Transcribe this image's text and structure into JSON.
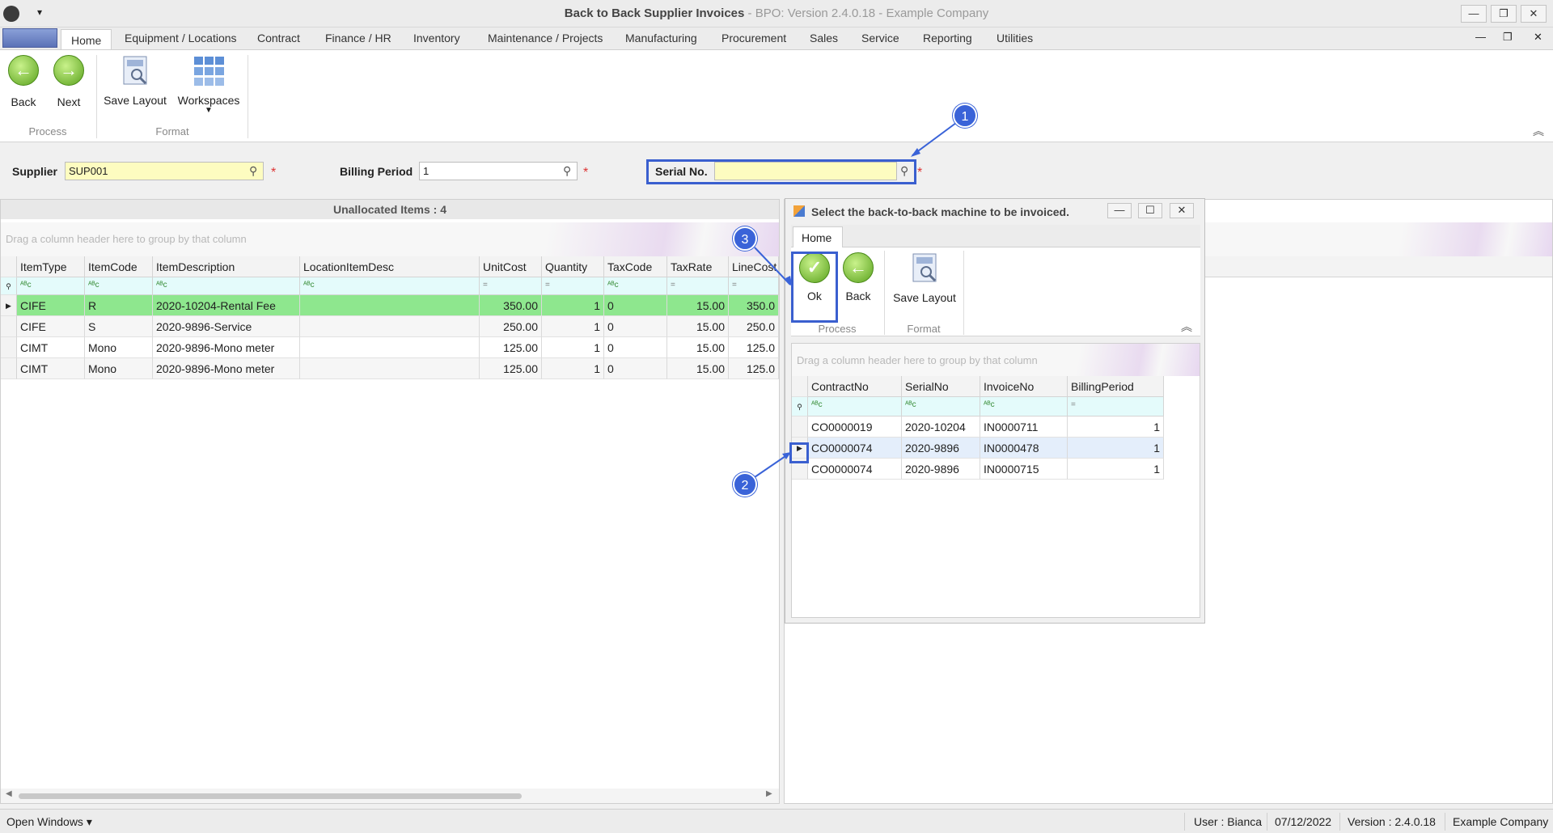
{
  "window": {
    "title_main": "Back to Back Supplier Invoices",
    "title_sub": "- BPO: Version 2.4.0.18 - Example Company"
  },
  "tabs": [
    "Home",
    "Equipment / Locations",
    "Contract",
    "Finance / HR",
    "Inventory",
    "Maintenance / Projects",
    "Manufacturing",
    "Procurement",
    "Sales",
    "Service",
    "Reporting",
    "Utilities"
  ],
  "ribbon": {
    "back": "Back",
    "next": "Next",
    "save_layout": "Save Layout",
    "workspaces": "Workspaces",
    "group_process": "Process",
    "group_format": "Format"
  },
  "filters": {
    "supplier_label": "Supplier",
    "supplier_value": "SUP001",
    "billing_label": "Billing Period",
    "billing_value": "1",
    "serial_label": "Serial No.",
    "serial_value": "",
    "req": "*"
  },
  "left_grid": {
    "header": "Unallocated Items : 4",
    "group_hint": "Drag a column header here to group by that column",
    "columns": [
      "ItemType",
      "ItemCode",
      "ItemDescription",
      "LocationItemDesc",
      "UnitCost",
      "Quantity",
      "TaxCode",
      "TaxRate",
      "LineCost"
    ],
    "rows": [
      [
        "CIFE",
        "R",
        "2020-10204-Rental Fee",
        "",
        "350.00",
        "1",
        "0",
        "15.00",
        "350.0"
      ],
      [
        "CIFE",
        "S",
        "2020-9896-Service",
        "",
        "250.00",
        "1",
        "0",
        "15.00",
        "250.0"
      ],
      [
        "CIMT",
        "Mono",
        "2020-9896-Mono meter",
        "",
        "125.00",
        "1",
        "0",
        "15.00",
        "125.0"
      ],
      [
        "CIMT",
        "Mono",
        "2020-9896-Mono meter",
        "",
        "125.00",
        "1",
        "0",
        "15.00",
        "125.0"
      ]
    ]
  },
  "dialog": {
    "title": "Select the back-to-back machine to be invoiced.",
    "tab": "Home",
    "ok": "Ok",
    "back": "Back",
    "save_layout": "Save Layout",
    "group_process": "Process",
    "group_format": "Format",
    "group_hint": "Drag a column header here to group by that column",
    "columns": [
      "ContractNo",
      "SerialNo",
      "InvoiceNo",
      "BillingPeriod"
    ],
    "rows": [
      [
        "CO0000019",
        "2020-10204",
        "IN0000711",
        "1"
      ],
      [
        "CO0000074",
        "2020-9896",
        "IN0000478",
        "1"
      ],
      [
        "CO0000074",
        "2020-9896",
        "IN0000715",
        "1"
      ]
    ]
  },
  "callouts": [
    "1",
    "2",
    "3"
  ],
  "status": {
    "open_windows": "Open Windows ▾",
    "user": "User : Bianca",
    "date": "07/12/2022",
    "version": "Version : 2.4.0.18",
    "company": "Example Company"
  },
  "colors": {
    "accent": "#3a63d8",
    "selected_row": "#8ee78e",
    "yellow_field": "#fdfcc0",
    "filter_row": "#e4fbfb"
  }
}
